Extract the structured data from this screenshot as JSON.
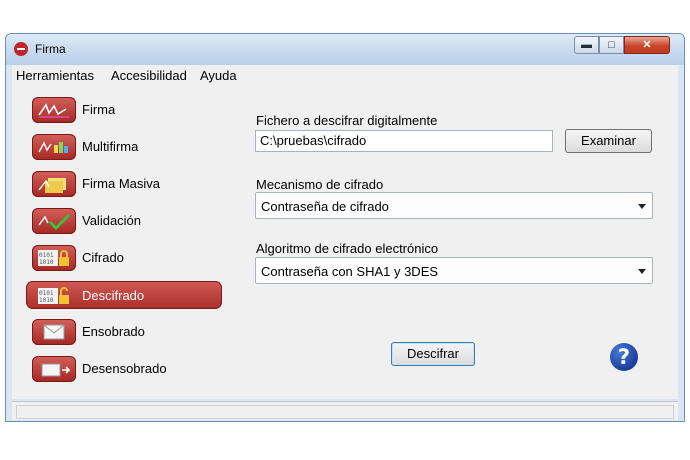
{
  "window": {
    "title": "Firma"
  },
  "menu": [
    {
      "label": "Herramientas"
    },
    {
      "label": "Accesibilidad"
    },
    {
      "label": "Ayuda"
    }
  ],
  "nav": [
    {
      "label": "Firma",
      "icon": "signature-icon"
    },
    {
      "label": "Multifirma",
      "icon": "multisign-icon"
    },
    {
      "label": "Firma Masiva",
      "icon": "mass-sign-icon"
    },
    {
      "label": "Validación",
      "icon": "check-icon"
    },
    {
      "label": "Cifrado",
      "icon": "lock-binary-icon"
    },
    {
      "label": "Descifrado",
      "icon": "unlock-binary-icon",
      "active": true
    },
    {
      "label": "Ensobrado",
      "icon": "envelope-icon"
    },
    {
      "label": "Desensobrado",
      "icon": "open-envelope-icon"
    }
  ],
  "form": {
    "file_label": "Fichero a descifrar digitalmente",
    "file_value": "C:\\pruebas\\cifrado",
    "browse_label": "Examinar",
    "mechanism_label": "Mecanismo de cifrado",
    "mechanism_value": "Contraseña de cifrado",
    "algorithm_label": "Algoritmo de cifrado electrónico",
    "algorithm_value": "Contraseña con SHA1 y 3DES",
    "decrypt_label": "Descifrar"
  },
  "help": {
    "icon": "help-icon",
    "glyph": "?"
  },
  "colors": {
    "accent": "#b3342e",
    "help": "#2a56c6"
  }
}
